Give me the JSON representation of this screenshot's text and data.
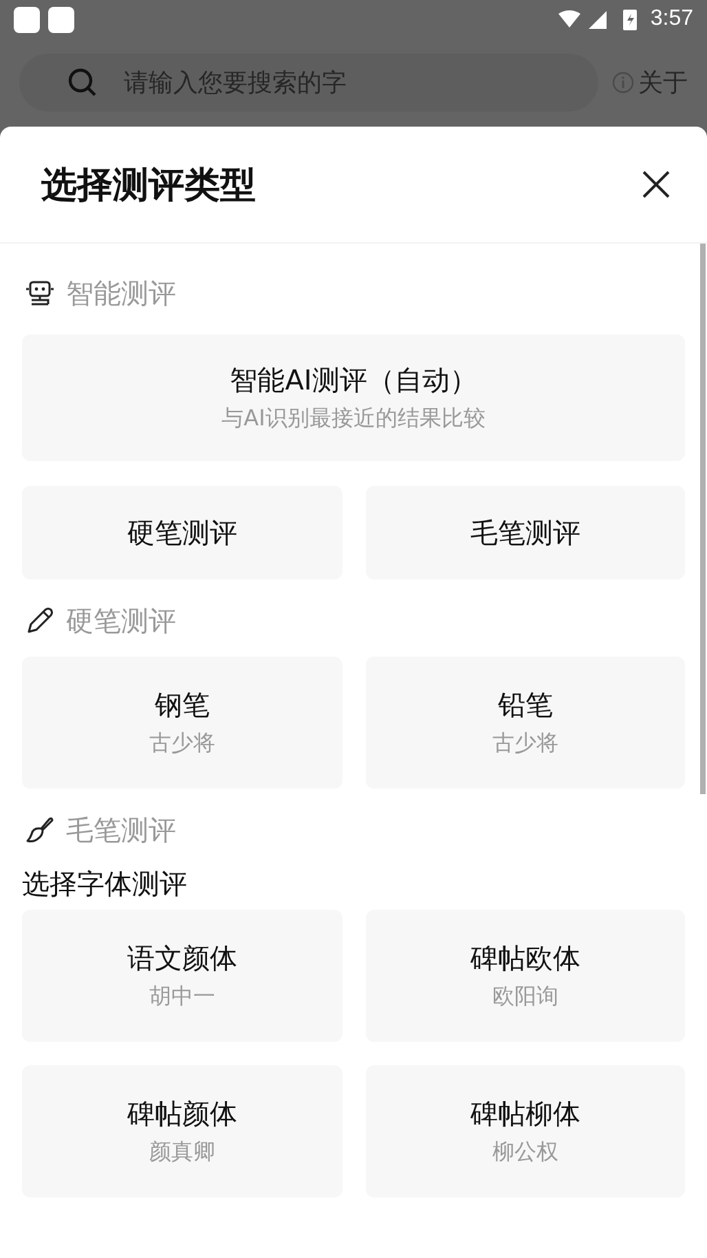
{
  "status_bar": {
    "time": "3:57"
  },
  "search": {
    "placeholder": "请输入您要搜索的字"
  },
  "about_link": "关于",
  "sheet": {
    "title": "选择测评类型",
    "sections": [
      {
        "kind": "ai",
        "title": "智能测评",
        "featured": {
          "title": "智能AI测评（自动）",
          "subtitle": "与AI识别最接近的结果比较"
        },
        "cards": [
          {
            "title": "硬笔测评"
          },
          {
            "title": "毛笔测评"
          }
        ]
      },
      {
        "kind": "pen",
        "title": "硬笔测评",
        "cards": [
          {
            "title": "钢笔",
            "subtitle": "古少将"
          },
          {
            "title": "铅笔",
            "subtitle": "古少将"
          }
        ]
      },
      {
        "kind": "brush",
        "title": "毛笔测评",
        "subheading": "选择字体测评",
        "cards": [
          {
            "title": "语文颜体",
            "subtitle": "胡中一"
          },
          {
            "title": "碑帖欧体",
            "subtitle": "欧阳询"
          },
          {
            "title": "碑帖颜体",
            "subtitle": "颜真卿"
          },
          {
            "title": "碑帖柳体",
            "subtitle": "柳公权"
          }
        ]
      }
    ]
  }
}
